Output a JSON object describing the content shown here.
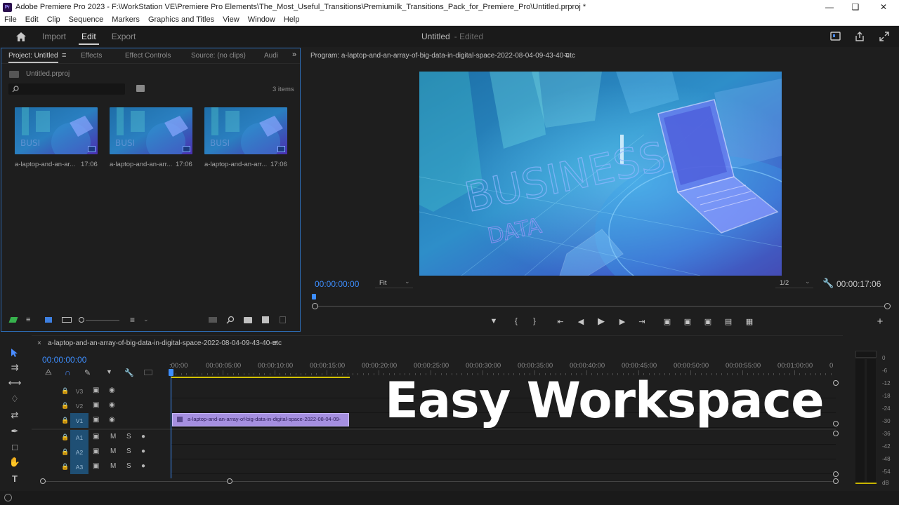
{
  "window": {
    "app_icon": "Pr",
    "title": "Adobe Premiere Pro 2023 - F:\\WorkStation VE\\Premiere Pro Elements\\The_Most_Useful_Transitions\\Premiumilk_Transitions_Pack_for_Premiere_Pro\\Untitled.prproj *"
  },
  "menu": [
    "File",
    "Edit",
    "Clip",
    "Sequence",
    "Markers",
    "Graphics and Titles",
    "View",
    "Window",
    "Help"
  ],
  "header": {
    "tabs": [
      "Import",
      "Edit",
      "Export"
    ],
    "active_tab": "Edit",
    "doc_name": "Untitled",
    "doc_status": "- Edited"
  },
  "project": {
    "tabs": [
      "Project: Untitled",
      "Effects",
      "Effect Controls",
      "Source: (no clips)",
      "Audi"
    ],
    "file": "Untitled.prproj",
    "items_count": "3 items",
    "clips": [
      {
        "name": "a-laptop-and-an-ar...",
        "duration": "17:06"
      },
      {
        "name": "a-laptop-and-an-arr...",
        "duration": "17:06"
      },
      {
        "name": "a-laptop-and-an-arr...",
        "duration": "17:06"
      }
    ]
  },
  "program": {
    "title": "Program: a-laptop-and-an-array-of-big-data-in-digital-space-2022-08-04-09-43-40-utc",
    "timecode": "00:00:00:00",
    "fit": "Fit",
    "resolution": "1/2",
    "duration": "00:00:17:06",
    "video_text_1": "BUSINESS",
    "video_text_2": "DATA"
  },
  "timeline": {
    "sequence": "a-laptop-and-an-array-of-big-data-in-digital-space-2022-08-04-09-43-40-utc",
    "timecode": "00:00:00:00",
    "ruler": [
      ":00:00",
      "00:00:05:00",
      "00:00:10:00",
      "00:00:15:00",
      "00:00:20:00",
      "00:00:25:00",
      "00:00:30:00",
      "00:00:35:00",
      "00:00:40:00",
      "00:00:45:00",
      "00:00:50:00",
      "00:00:55:00",
      "00:01:00:00",
      "0"
    ],
    "tracks": [
      "V3",
      "V2",
      "V1",
      "A1",
      "A2",
      "A3"
    ],
    "clip_label": "a-laptop-and-an-array-of-big-data-in-digital-space-2022-08-04-09-",
    "audio_m": "M",
    "audio_s": "S"
  },
  "meter": {
    "scale": [
      "0",
      "-6",
      "-12",
      "-18",
      "-24",
      "-30",
      "-36",
      "-42",
      "-48",
      "-54",
      "dB"
    ]
  },
  "overlay": "Easy Workspace",
  "colors": {
    "accent_blue": "#3d8eff",
    "clip_violet": "#a58fe0",
    "panel_border": "#2d6cb5"
  }
}
